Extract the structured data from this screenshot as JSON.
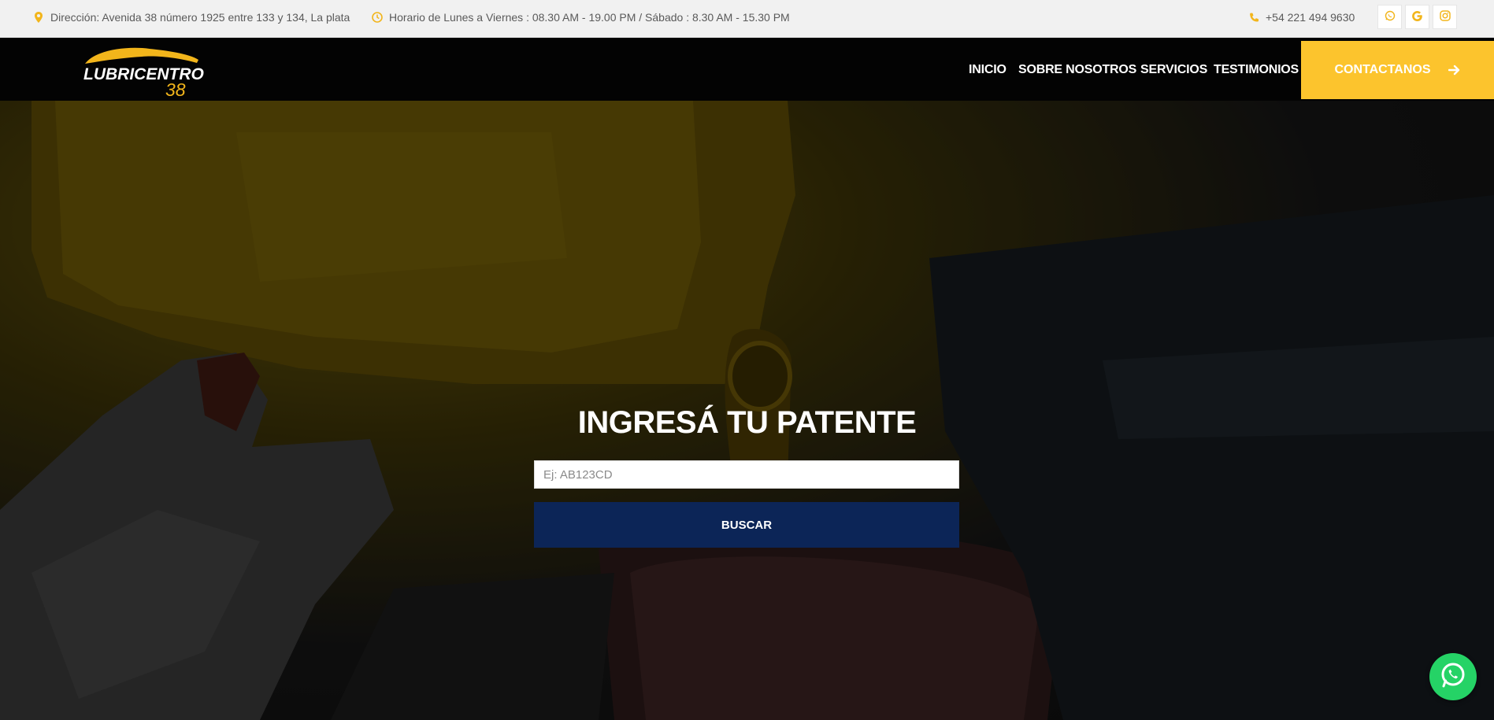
{
  "topbar": {
    "address": "Dirección: Avenida 38 número 1925 entre 133 y 134, La plata",
    "hours": "Horario de Lunes a Viernes : 08.30 AM - 19.00 PM / Sábado : 8.30 AM - 15.30 PM",
    "phone": "+54 221 494 9630",
    "icons": [
      "location-pin-icon",
      "clock-icon",
      "phone-icon",
      "whatsapp-icon",
      "google-icon",
      "instagram-icon"
    ]
  },
  "logo": {
    "line1": "LUBRICENTRO",
    "line2": "38"
  },
  "nav": {
    "items": [
      "INICIO",
      "SOBRE NOSOTROS",
      "SERVICIOS",
      "TESTIMONIOS"
    ],
    "cta_label": "CONTACTANOS"
  },
  "hero": {
    "title": "INGRESÁ TU PATENTE",
    "input_placeholder": "Ej: AB123CD",
    "button_label": "BUSCAR"
  },
  "colors": {
    "accent": "#fcc42d",
    "button": "#0c2557",
    "whatsapp": "#25d366",
    "icon_yellow": "#f2b51b"
  }
}
